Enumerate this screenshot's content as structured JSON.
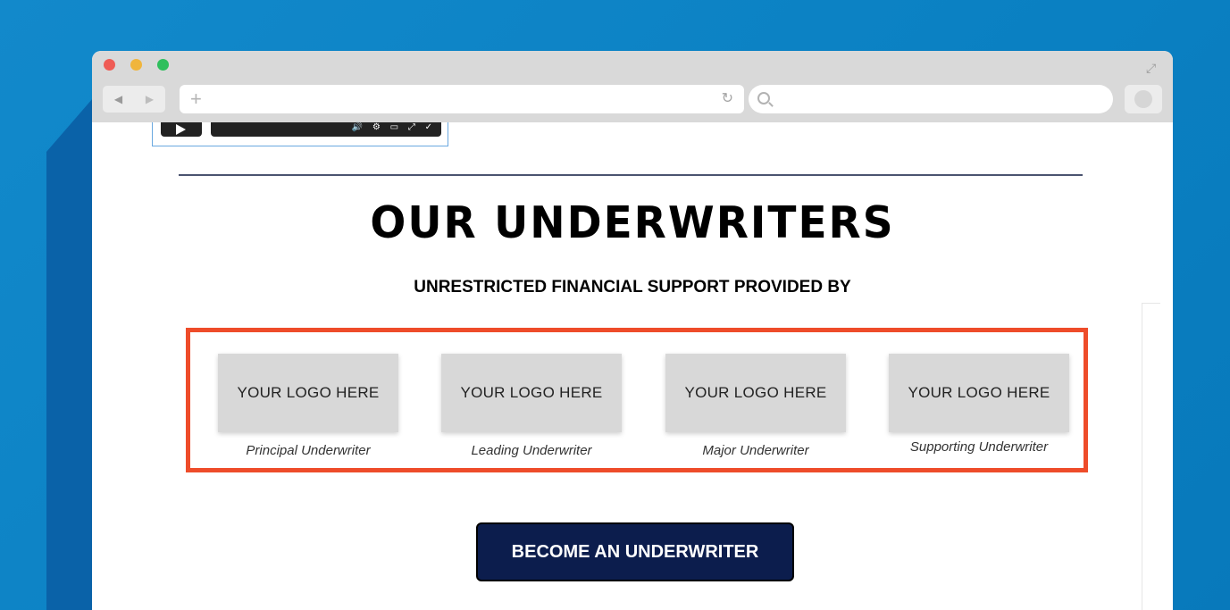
{
  "browser": {
    "nav_back": "◀",
    "nav_forward": "▶",
    "new_tab": "+",
    "reload": "↻",
    "expand": "⤢"
  },
  "player": {
    "controls": "🔊 ⚙ ▭ ⤢ ✓"
  },
  "page": {
    "title": "OUR UNDERWRITERS",
    "subtitle": "UNRESTRICTED FINANCIAL SUPPORT PROVIDED BY",
    "logos": [
      {
        "placeholder": "YOUR LOGO HERE",
        "label": "Principal Underwriter"
      },
      {
        "placeholder": "YOUR LOGO HERE",
        "label": "Leading Underwriter"
      },
      {
        "placeholder": "YOUR LOGO HERE",
        "label": "Major Underwriter"
      },
      {
        "placeholder": "YOUR LOGO HERE",
        "label": "Supporting Underwriter"
      }
    ],
    "cta_label": "BECOME AN UNDERWRITER"
  },
  "colors": {
    "background": "#0b83c5",
    "highlight_border": "#ee4c2a",
    "cta_background": "#0c1d4d",
    "logo_placeholder": "#d8d8d8"
  }
}
